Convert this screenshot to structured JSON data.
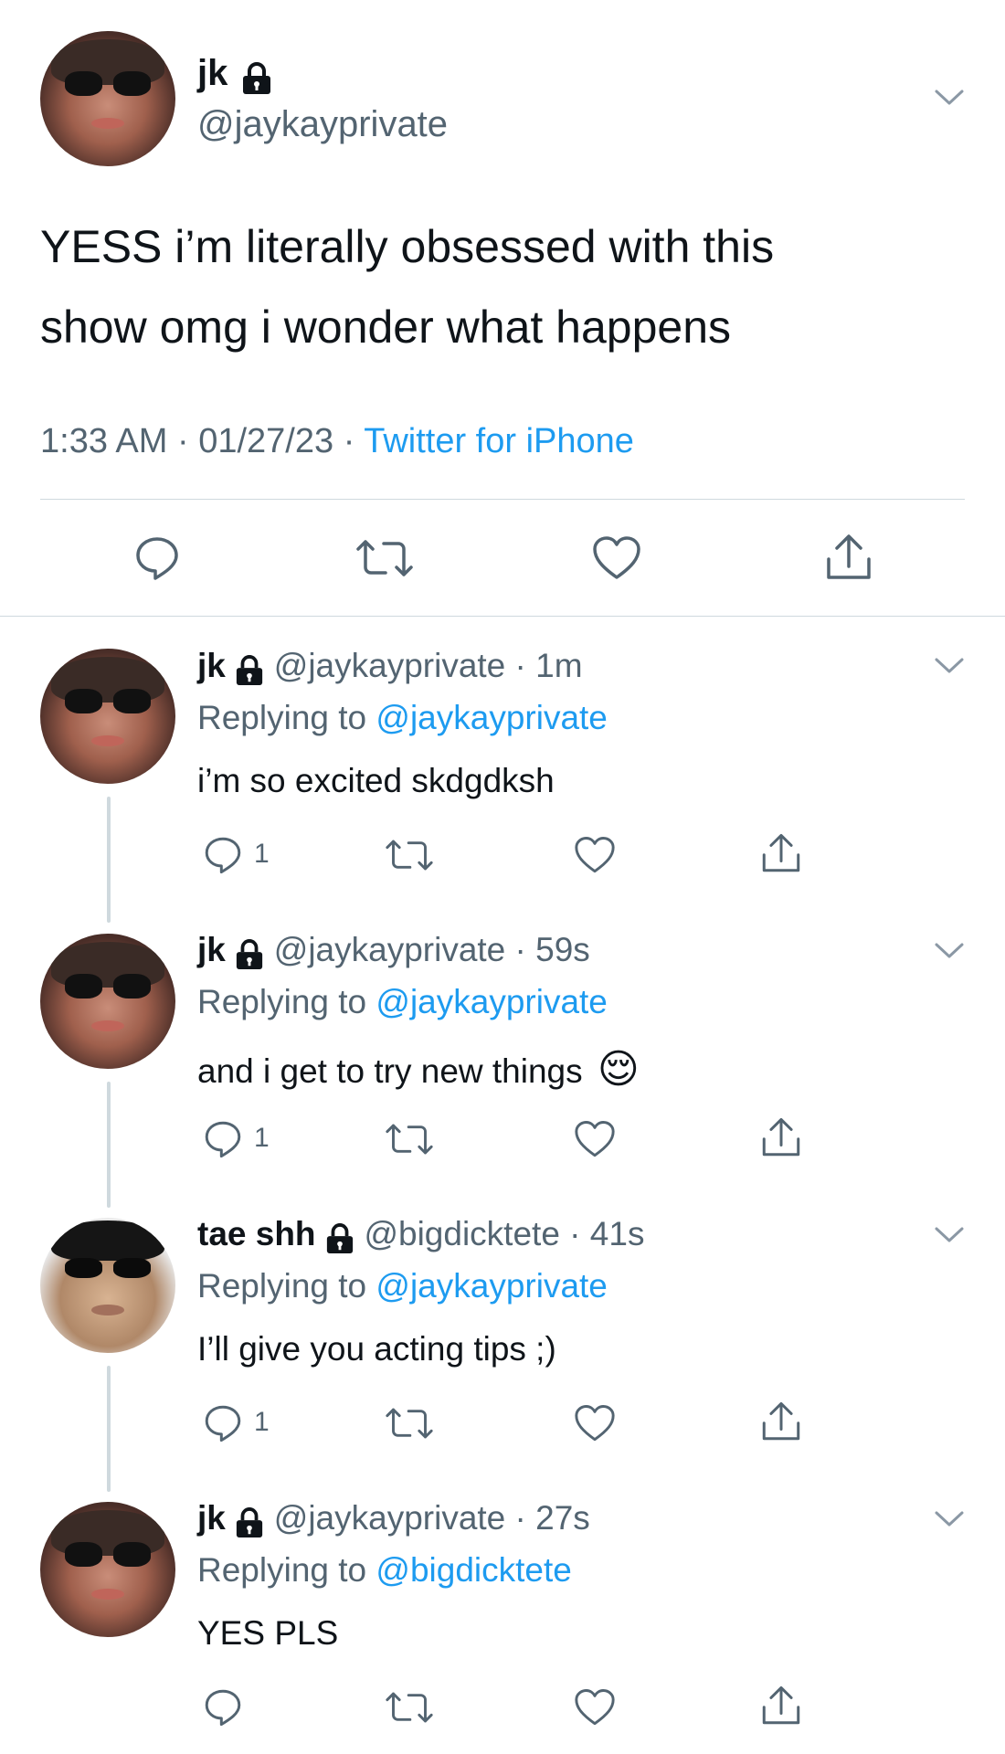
{
  "main_tweet": {
    "display_name": "jk",
    "handle": "@jaykayprivate",
    "text_line1": "YESS i’m literally obsessed with this",
    "text_line2": "show omg i wonder what happens",
    "time": "1:33 AM",
    "date": "01/27/23",
    "source": "Twitter for iPhone",
    "sep": "·"
  },
  "replies": [
    {
      "display_name": "jk",
      "handle": "@jaykayprivate",
      "time": "1m",
      "replying_prefix": "Replying to",
      "replying_to": "@jaykayprivate",
      "text": "i’m so excited skdgdksh",
      "reply_count": "1"
    },
    {
      "display_name": "jk",
      "handle": "@jaykayprivate",
      "time": "59s",
      "replying_prefix": "Replying to",
      "replying_to": "@jaykayprivate",
      "text": "and i get to try new things",
      "emoji": "😌",
      "reply_count": "1"
    },
    {
      "display_name": "tae shh",
      "handle": "@bigdicktete",
      "time": "41s",
      "replying_prefix": "Replying to",
      "replying_to": "@jaykayprivate",
      "text": "I’ll give you acting tips ;)",
      "reply_count": "1"
    },
    {
      "display_name": "jk",
      "handle": "@jaykayprivate",
      "time": "27s",
      "replying_prefix": "Replying to",
      "replying_to": "@bigdicktete",
      "text": "YES PLS",
      "reply_count": ""
    }
  ],
  "colors": {
    "text": "#0f1419",
    "secondary": "#536471",
    "accent": "#1d9bf0",
    "divider": "#cfd9de"
  },
  "icons": [
    "lock-icon",
    "chevron-down-icon",
    "reply-icon",
    "retweet-icon",
    "like-icon",
    "share-icon"
  ]
}
